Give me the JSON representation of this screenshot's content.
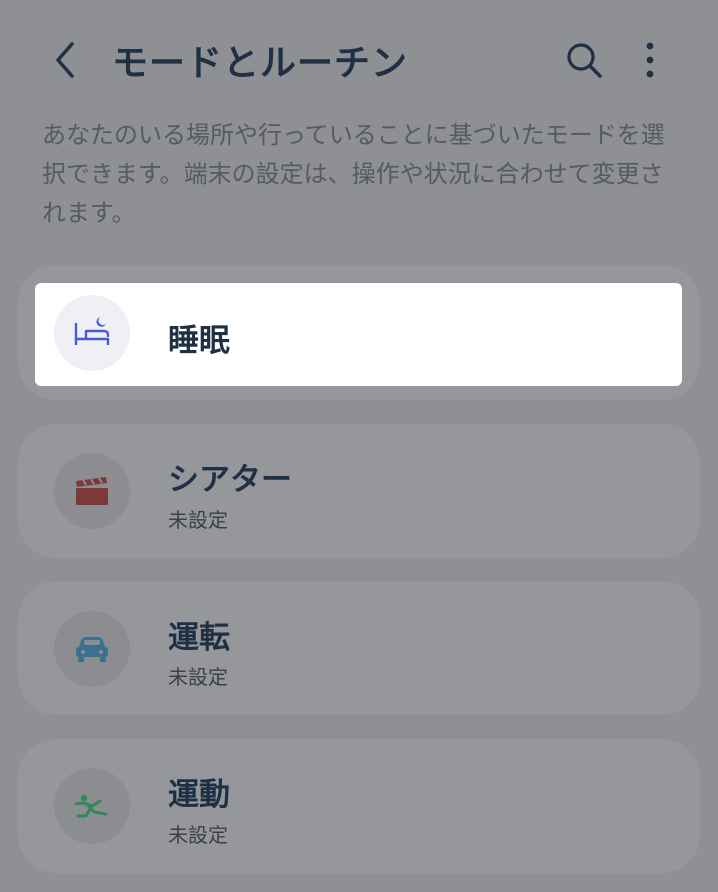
{
  "header": {
    "title": "モードとルーチン"
  },
  "description": "あなたのいる場所や行っていることに基づいたモードを選択できます。端末の設定は、操作や状況に合わせて変更されます。",
  "modes": [
    {
      "label": "睡眠",
      "status": "",
      "icon": "bed-moon-icon",
      "color": "#4a5ad6"
    },
    {
      "label": "シアター",
      "status": "未設定",
      "icon": "clapperboard-icon",
      "color": "#7e3837"
    },
    {
      "label": "運転",
      "status": "未設定",
      "icon": "car-icon",
      "color": "#3d6f8e"
    },
    {
      "label": "運動",
      "status": "未設定",
      "icon": "running-icon",
      "color": "#2f8a56"
    }
  ]
}
